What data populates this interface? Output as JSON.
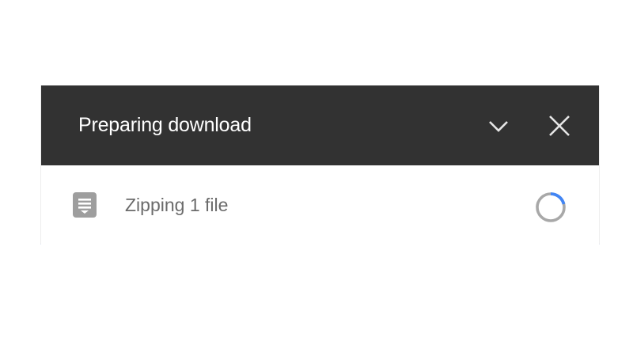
{
  "dialog": {
    "title": "Preparing download",
    "collapse_icon": "chevron-down-icon",
    "close_icon": "close-icon"
  },
  "item": {
    "icon": "file-document-icon",
    "status": "Zipping 1 file",
    "progress_icon": "loading-spinner-icon"
  },
  "colors": {
    "header_bg": "#323232",
    "header_text": "#ffffff",
    "status_text": "#6b6b6b",
    "spinner_track": "#9e9e9e",
    "spinner_accent": "#4285f4",
    "file_icon": "#9e9e9e"
  }
}
